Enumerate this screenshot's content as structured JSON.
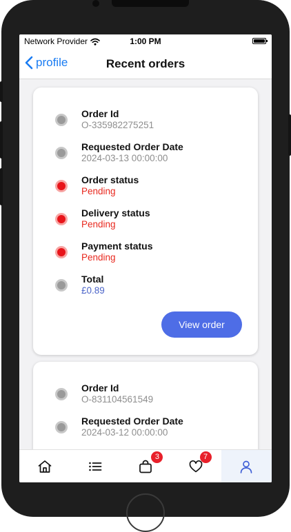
{
  "status_bar": {
    "carrier": "Network Provider",
    "time": "1:00 PM",
    "wifi_icon": "wifi-icon",
    "battery_icon": "battery-icon"
  },
  "nav": {
    "back_label": "profile",
    "title": "Recent orders"
  },
  "orders": [
    {
      "order_id_label": "Order Id",
      "order_id": "O-335982275251",
      "requested_date_label": "Requested Order Date",
      "requested_date": "2024-03-13 00:00:00",
      "order_status_label": "Order status",
      "order_status": "Pending",
      "delivery_status_label": "Delivery status",
      "delivery_status": "Pending",
      "payment_status_label": "Payment status",
      "payment_status": "Pending",
      "total_label": "Total",
      "total": "£0.89",
      "view_label": "View order"
    },
    {
      "order_id_label": "Order Id",
      "order_id": "O-831104561549",
      "requested_date_label": "Requested Order Date",
      "requested_date": "2024-03-12 00:00:00"
    }
  ],
  "tabbar": {
    "items": [
      {
        "icon": "home-icon"
      },
      {
        "icon": "list-icon"
      },
      {
        "icon": "shopping-bag-icon",
        "badge": "3"
      },
      {
        "icon": "heart-icon",
        "badge": "7"
      },
      {
        "icon": "user-icon",
        "active": true
      }
    ]
  },
  "colors": {
    "accent": "#4e6de6",
    "link": "#1a7cf2",
    "pending": "#e8281e",
    "total": "#4a63c8",
    "badge": "#e8202a"
  }
}
